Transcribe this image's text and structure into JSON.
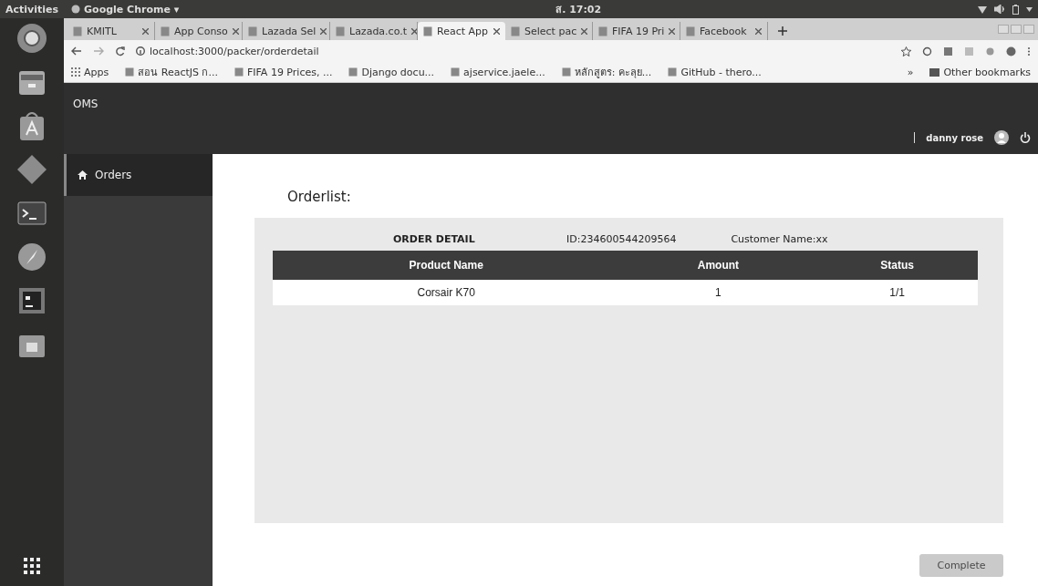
{
  "top_bar": {
    "activities": "Activities",
    "app_menu": "Google Chrome ▾",
    "clock": "ส. 17:02"
  },
  "browser": {
    "tabs": [
      {
        "title": "KMITL",
        "selected": false
      },
      {
        "title": "App Conso",
        "selected": false
      },
      {
        "title": "Lazada Sel",
        "selected": false
      },
      {
        "title": "Lazada.co.t",
        "selected": false
      },
      {
        "title": "React App",
        "selected": true
      },
      {
        "title": "Select pac",
        "selected": false
      },
      {
        "title": "FIFA 19 Pri",
        "selected": false
      },
      {
        "title": "Facebook",
        "selected": false
      }
    ],
    "address": "localhost:3000/packer/orderdetail",
    "bookmarks": [
      "Apps",
      "สอน ReactJS ก...",
      "FIFA 19 Prices, ...",
      "Django docu...",
      "ajservice.jaele...",
      "หลักสูตร: คะลุย...",
      "GitHub - thero..."
    ],
    "overflow": "»",
    "other_bookmarks": "Other bookmarks"
  },
  "app": {
    "brand": "OMS",
    "user": "danny rose",
    "sidebar": [
      {
        "label": "Orders",
        "selected": true
      }
    ],
    "page_title": "Orderlist:",
    "order": {
      "heading": "ORDER DETAIL",
      "id": "ID:234600544209564",
      "customer": "Customer Name:xx"
    },
    "table": {
      "columns": [
        "Product Name",
        "Amount",
        "Status"
      ],
      "rows": [
        [
          "Corsair K70",
          "1",
          "1/1"
        ]
      ]
    },
    "complete_button": {
      "label": "Complete",
      "disabled": true
    }
  }
}
